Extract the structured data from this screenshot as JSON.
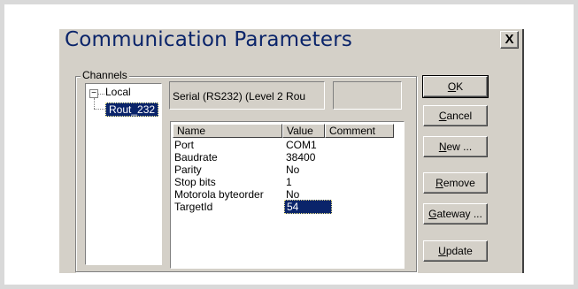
{
  "dialog": {
    "title": "Communication Parameters",
    "close_label": "X"
  },
  "channels": {
    "label": "Channels",
    "tree": {
      "toggle": "−",
      "root": "Local",
      "child": "Rout_232"
    }
  },
  "connection": {
    "name": "Serial (RS232) (Level 2 Rou",
    "extra": ""
  },
  "params": {
    "columns": [
      "Name",
      "Value",
      "Comment"
    ],
    "rows": [
      {
        "name": "Port",
        "value": "COM1",
        "comment": ""
      },
      {
        "name": "Baudrate",
        "value": "38400",
        "comment": ""
      },
      {
        "name": "Parity",
        "value": "No",
        "comment": ""
      },
      {
        "name": "Stop bits",
        "value": "1",
        "comment": ""
      },
      {
        "name": "Motorola byteorder",
        "value": "No",
        "comment": ""
      },
      {
        "name": "TargetId",
        "value": "54",
        "comment": ""
      }
    ]
  },
  "buttons": {
    "ok": {
      "key": "O",
      "rest": "K"
    },
    "cancel": {
      "key": "C",
      "rest": "ancel"
    },
    "new": {
      "key": "N",
      "rest": "ew ..."
    },
    "remove": {
      "key": "R",
      "rest": "emove"
    },
    "gateway": {
      "key": "G",
      "rest": "ateway ..."
    },
    "update": {
      "key": "U",
      "rest": "pdate"
    }
  }
}
